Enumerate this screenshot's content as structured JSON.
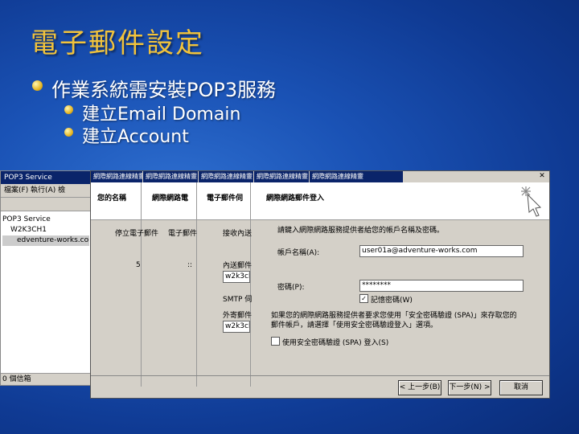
{
  "slide": {
    "title": "電子郵件設定",
    "bullet1": "作業系統需安裝POP3服務",
    "bullet2": "建立Email Domain",
    "bullet3": "建立Account"
  },
  "mmc": {
    "title": "POP3 Service",
    "menu": "檔案(F)  執行(A)  檢",
    "tree": [
      "POP3 Service",
      "W2K3CH1",
      "edventure-works.com"
    ],
    "status": "0 個信箱"
  },
  "wizard": {
    "tabs": [
      "網際網路連線精靈",
      "網際網路連線精靈",
      "網際網路連線精靈",
      "網際網路連線精靈",
      "網際網路連線精靈"
    ],
    "close": "✕",
    "header_cols": [
      "您的名稱",
      "網際網路電",
      "電子郵件伺",
      "網際網路郵件登入"
    ],
    "col_text": [
      "停立電子郵件",
      "電子郵件",
      "接收內送",
      "內送郵件",
      "SMTP 伺",
      "外寄郵件"
    ],
    "mid_labels": [
      "5",
      "::"
    ],
    "intro": "請鍵入網際網路服務提供者給您的帳戶名稱及密碼。",
    "account_label": "帳戶名稱(A):",
    "account_value": "user01a@adventure-works.com",
    "password_label": "密碼(P):",
    "password_value": "********",
    "remember": "記憶密碼(W)",
    "note1": "如果您的網際網路服務提供者要求您使用「安全密碼驗證 (SPA)」來存取您的",
    "note2": "郵件帳戶，請選擇「使用安全密碼驗證登入」選項。",
    "spa": "使用安全密碼驗證 (SPA) 登入(S)",
    "srv_values": [
      "w2k3ch1",
      "w2k3ch1"
    ],
    "back": "< 上一步(B)",
    "next": "下一步(N) >",
    "cancel": "取消"
  }
}
